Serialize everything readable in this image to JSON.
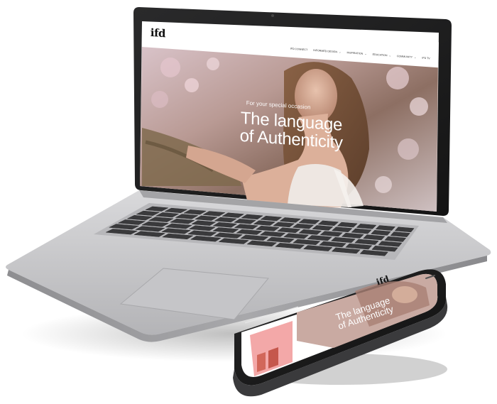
{
  "laptop": {
    "site": {
      "logo": "ifd",
      "nav": [
        {
          "label": "IFD CONNECT",
          "has_menu": false
        },
        {
          "label": "INFORMED DESIGN",
          "has_menu": true
        },
        {
          "label": "INSPIRATION",
          "has_menu": true
        },
        {
          "label": "EDUCATION",
          "has_menu": true
        },
        {
          "label": "COMMUNITY",
          "has_menu": true
        },
        {
          "label": "IFD TV",
          "has_menu": false
        }
      ],
      "hero": {
        "subtitle": "For your special occasion",
        "title_line1": "The language",
        "title_line2": "of Authenticity"
      }
    }
  },
  "phone": {
    "logo": "ifd",
    "title_line1": "The language",
    "title_line2": "of Authenticity"
  },
  "colors": {
    "laptop_body": "#c9c9cb",
    "bezel": "#1b1b1c",
    "key": "#3a3a3c",
    "trackpad": "#bdbdbf",
    "pink_block": "#f3a8a8"
  }
}
